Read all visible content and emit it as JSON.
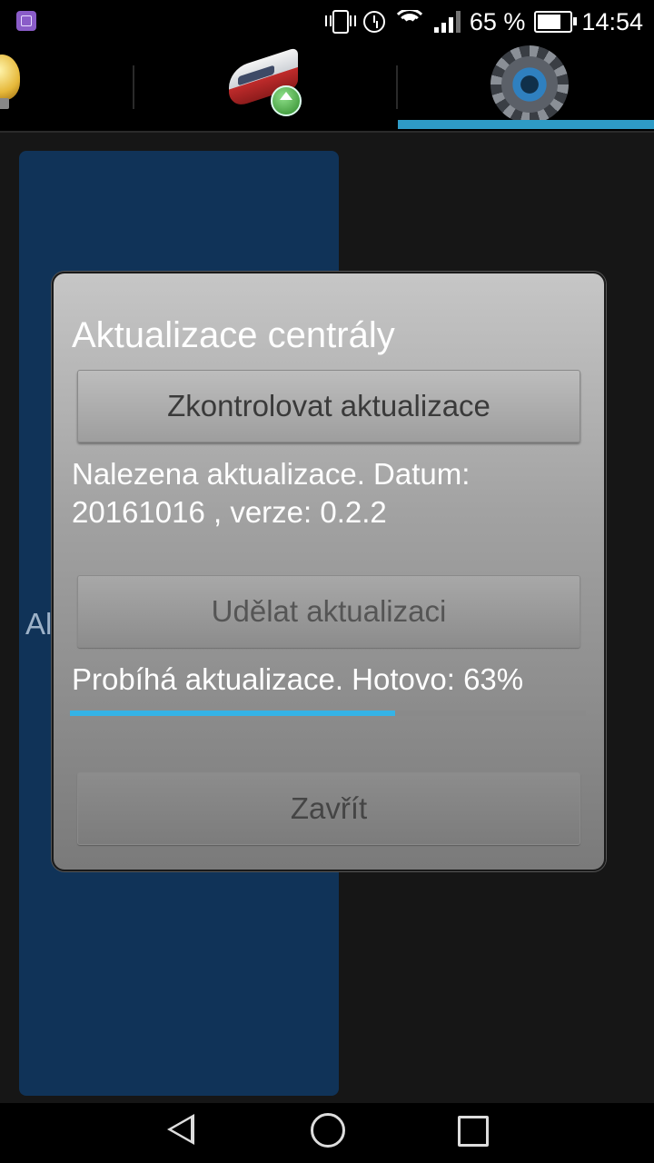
{
  "status_bar": {
    "battery_percent": "65 %",
    "time": "14:54",
    "icons": [
      "gallery-notification-icon",
      "vibrate-icon",
      "alarm-icon",
      "wifi-icon",
      "signal-icon",
      "battery-icon"
    ]
  },
  "tabs": [
    {
      "icon": "lightbulb-icon",
      "selected": false
    },
    {
      "icon": "train-update-icon",
      "selected": false
    },
    {
      "icon": "gear-icon",
      "selected": true
    }
  ],
  "colors": {
    "accent": "#2e9bc6",
    "progress": "#35b3e6",
    "panel": "#103358"
  },
  "background": {
    "label": "Al"
  },
  "dialog": {
    "title": "Aktualizace centrály",
    "check_button": "Zkontrolovat aktualizace",
    "found_text": "Nalezena aktualizace. Datum: 20161016 , verze: 0.2.2",
    "update_button": "Udělat aktualizaci",
    "progress_text": "Probíhá aktualizace. Hotovo: 63%",
    "progress_value": 0.63,
    "close_button": "Zavřít"
  },
  "nav_bar": {
    "buttons": [
      "back-icon",
      "home-icon",
      "recent-apps-icon"
    ]
  }
}
